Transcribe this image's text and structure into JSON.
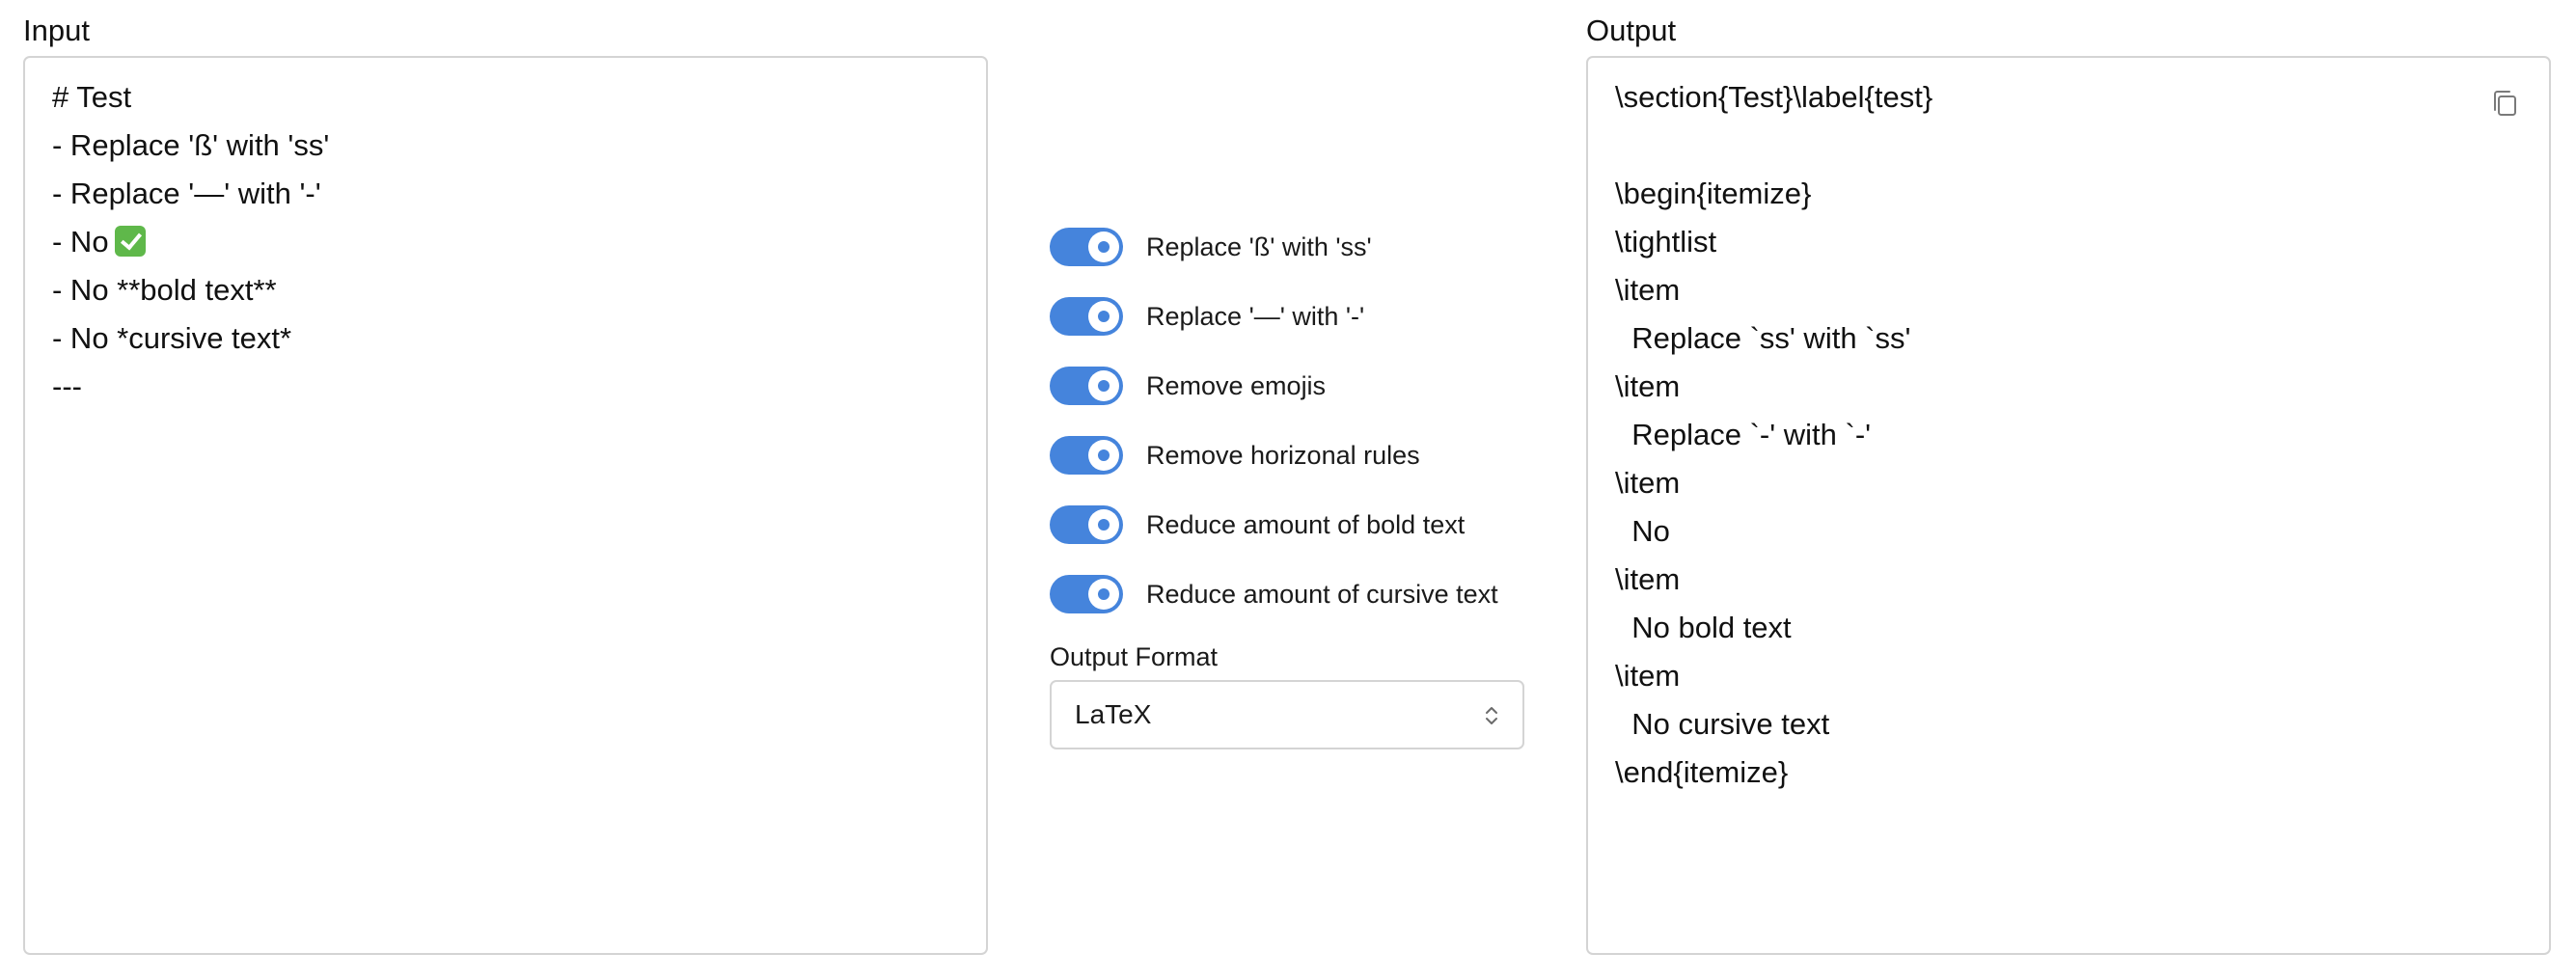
{
  "input": {
    "label": "Input",
    "lines": [
      "# Test",
      "- Replace 'ß' with 'ss'",
      "- Replace '—' with '-'",
      "- No",
      "- No **bold text**",
      "- No *cursive text*",
      "---"
    ],
    "emoji_on_line": 3,
    "emoji_icon": "check-mark-button-emoji"
  },
  "output": {
    "label": "Output",
    "copy_icon": "copy-icon",
    "lines": [
      "\\section{Test}\\label{test}",
      "",
      "\\begin{itemize}",
      "\\tightlist",
      "\\item",
      "  Replace `ss' with `ss'",
      "\\item",
      "  Replace `-' with `-'",
      "\\item",
      "  No",
      "\\item",
      "  No bold text",
      "\\item",
      "  No cursive text",
      "\\end{itemize}"
    ]
  },
  "options": [
    {
      "label": "Replace 'ß' with 'ss'",
      "enabled": true
    },
    {
      "label": "Replace '—' with '-'",
      "enabled": true
    },
    {
      "label": "Remove emojis",
      "enabled": true
    },
    {
      "label": "Remove horizonal rules",
      "enabled": true
    },
    {
      "label": "Reduce amount of bold text",
      "enabled": true
    },
    {
      "label": "Reduce amount of cursive text",
      "enabled": true
    }
  ],
  "output_format": {
    "label": "Output Format",
    "selected": "LaTeX",
    "icon": "chevron-up-down-icon"
  },
  "colors": {
    "toggle_on": "#4584dc",
    "border": "#d4d4d4"
  }
}
